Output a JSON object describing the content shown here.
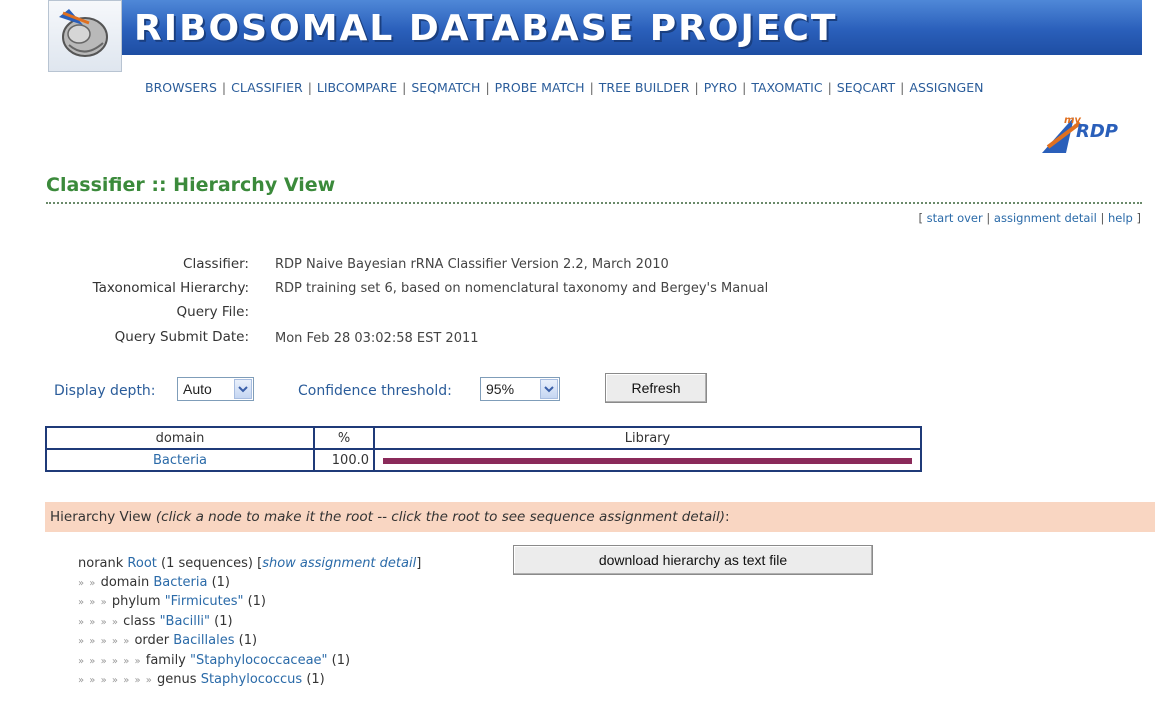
{
  "header": {
    "title": "RIBOSOMAL DATABASE PROJECT",
    "logo_icon": "ribosome-logo-icon",
    "myrdp_logo_text": "my RDP",
    "nav": [
      "BROWSERS",
      "CLASSIFIER",
      "LIBCOMPARE",
      "SEQMATCH",
      "PROBE MATCH",
      "TREE BUILDER",
      "PYRO",
      "TAXOMATIC",
      "SEQCART",
      "ASSIGNGEN"
    ]
  },
  "page": {
    "title": "Classifier :: Hierarchy View",
    "actions": [
      "start over",
      "assignment detail",
      "help"
    ]
  },
  "info": {
    "classifier_label": "Classifier:",
    "classifier_value": "RDP Naive Bayesian rRNA Classifier Version 2.2, March 2010",
    "hierarchy_label": "Taxonomical Hierarchy:",
    "hierarchy_value": "RDP training set 6, based on nomenclatural taxonomy and Bergey's Manual",
    "query_file_label": "Query File:",
    "query_file_value": "",
    "submit_date_label": "Query Submit Date:",
    "submit_date_value": "Mon Feb 28 03:02:58 EST 2011"
  },
  "controls": {
    "depth_label": "Display depth:",
    "depth_value": "Auto",
    "confidence_label": "Confidence threshold:",
    "confidence_value": "95%",
    "refresh_label": "Refresh"
  },
  "table": {
    "headers": [
      "domain",
      "%",
      "Library"
    ],
    "rows": [
      {
        "domain": "Bacteria",
        "percent": "100.0",
        "fraction": 1.0
      }
    ],
    "bar_color": "#8a2a5a"
  },
  "hierarchy": {
    "band_prefix": "Hierarchy View ",
    "band_note": "(click a node to make it the root -- click the root to see sequence assignment detail)",
    "band_suffix": ":",
    "download_label": "download hierarchy as text file",
    "root": {
      "rank": "norank",
      "name": "Root",
      "count": " (1 sequences) [",
      "detail_link": "show assignment detail",
      "close": "]"
    },
    "nodes": [
      {
        "chevrons": "» »",
        "rank": "domain",
        "name": "Bacteria",
        "count": "(1)"
      },
      {
        "chevrons": "» » »",
        "rank": "phylum",
        "name": "\"Firmicutes\"",
        "count": "(1)"
      },
      {
        "chevrons": "» » » »",
        "rank": "class",
        "name": "\"Bacilli\"",
        "count": "(1)"
      },
      {
        "chevrons": "» » » » »",
        "rank": "order",
        "name": "Bacillales",
        "count": "(1)"
      },
      {
        "chevrons": "» » » » » »",
        "rank": "family",
        "name": "\"Staphylococcaceae\"",
        "count": "(1)"
      },
      {
        "chevrons": "» » » » » » »",
        "rank": "genus",
        "name": "Staphylococcus",
        "count": "(1)"
      }
    ]
  }
}
